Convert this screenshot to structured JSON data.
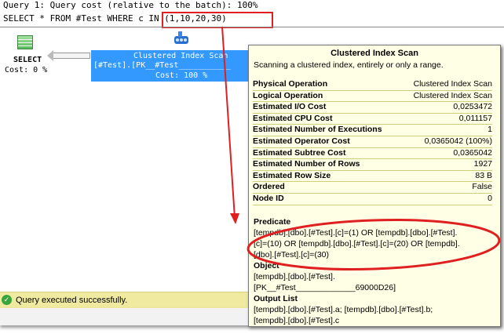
{
  "query": {
    "header": "Query 1: Query cost (relative to the batch): 100%",
    "sql_prefix": "SELECT * FROM #Test WHERE ",
    "sql_highlight": "c IN (1,10,20,30)"
  },
  "plan": {
    "select_node": {
      "label": "SELECT",
      "cost": "Cost: 0 %"
    },
    "scan_node": {
      "label": "Clustered Index Scan",
      "object": "[#Test].[PK__#Test___________",
      "cost": "Cost: 100 %"
    }
  },
  "status": {
    "text": "Query executed successfully.",
    "icon": "check-circle-icon",
    "color": "#3aa53a"
  },
  "tooltip": {
    "title": "Clustered Index Scan",
    "description": "Scanning a clustered index, entirely or only a range.",
    "rows": [
      {
        "k": "Physical Operation",
        "v": "Clustered Index Scan"
      },
      {
        "k": "Logical Operation",
        "v": "Clustered Index Scan"
      },
      {
        "k": "Estimated I/O Cost",
        "v": "0,0253472"
      },
      {
        "k": "Estimated CPU Cost",
        "v": "0,011157"
      },
      {
        "k": "Estimated Number of Executions",
        "v": "1"
      },
      {
        "k": "Estimated Operator Cost",
        "v": "0,0365042 (100%)"
      },
      {
        "k": "Estimated Subtree Cost",
        "v": "0,0365042"
      },
      {
        "k": "Estimated Number of Rows",
        "v": "1927"
      },
      {
        "k": "Estimated Row Size",
        "v": "83 B"
      },
      {
        "k": "Ordered",
        "v": "False"
      },
      {
        "k": "Node ID",
        "v": "0"
      }
    ],
    "predicate_label": "Predicate",
    "predicate": [
      "[tempdb].[dbo].[#Test].[c]=(1) OR [tempdb].[dbo].[#Test].",
      "[c]=(10) OR [tempdb].[dbo].[#Test].[c]=(20) OR [tempdb].",
      "[dbo].[#Test].[c]=(30)"
    ],
    "object_label": "Object",
    "object": [
      "[tempdb].[dbo].[#Test].",
      "[PK__#Test_____________69000D26]"
    ],
    "output_label": "Output List",
    "output": [
      "[tempdb].[dbo].[#Test].a; [tempdb].[dbo].[#Test].b;",
      "[tempdb].[dbo].[#Test].c"
    ]
  },
  "annotation_color": "#e02020"
}
